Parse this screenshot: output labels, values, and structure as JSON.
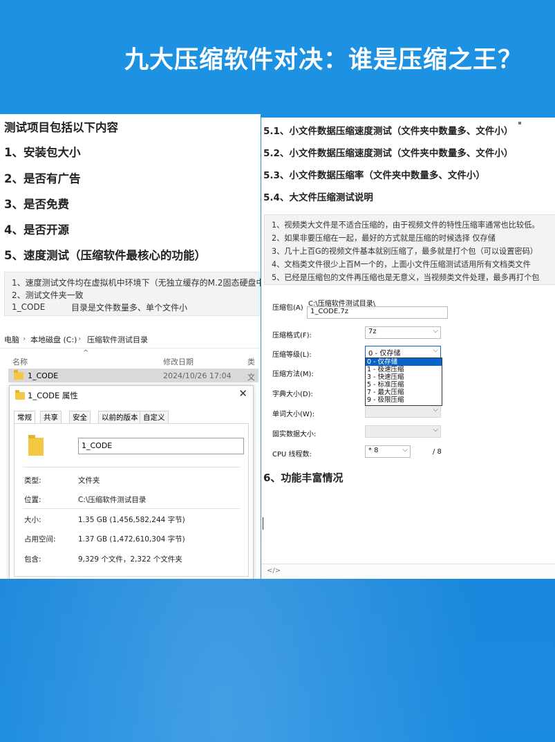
{
  "headline": "九大压缩软件对决：谁是压缩之王？",
  "left": {
    "heading": "测试项目包括以下内容",
    "items": [
      "1、安装包大小",
      "2、是否有广告",
      "3、是否免费",
      "4、是否开源",
      "5、速度测试（压缩软件最核心的功能）"
    ],
    "note_lines": [
      "1、速度测试文件均在虚拟机中环境下（无独立缓存的M.2固态硬盘中",
      "2、测试文件夹一致",
      "1_CODE",
      "目录是文件数量多、单个文件小"
    ],
    "explorer": {
      "breadcrumb": [
        "电脑",
        "本地磁盘 (C:)",
        "压缩软件测试目录"
      ],
      "columns": [
        "名称",
        "修改日期",
        "类"
      ],
      "file": {
        "name": "1_CODE",
        "date": "2024/10/26 17:04",
        "type": "文"
      }
    },
    "dialog": {
      "title": "1_CODE 属性",
      "close": "✕",
      "tabs": [
        "常规",
        "共享",
        "安全",
        "以前的版本",
        "自定义"
      ],
      "name": "1_CODE",
      "props": [
        {
          "label": "类型:",
          "value": "文件夹"
        },
        {
          "label": "位置:",
          "value": "C:\\压缩软件测试目录"
        },
        {
          "label": "大小:",
          "value": "1.35 GB (1,456,582,244 字节)"
        },
        {
          "label": "占用空间:",
          "value": "1.37 GB (1,472,610,304 字节)"
        },
        {
          "label": "包含:",
          "value": "9,329 个文件，2,322 个文件夹"
        }
      ]
    }
  },
  "right": {
    "headings": [
      "5.1、小文件数据压缩速度测试（文件夹中数量多、文件小）",
      "5.2、小文件数据压缩速度测试（文件夹中数量多、文件小）",
      "5.3、小文件数据压缩率（文件夹中数量多、文件小）",
      "5.4、大文件压缩测试说明"
    ],
    "notes": [
      "1、视频类大文件是不适合压缩的，由于视频文件的特性压缩率通常也比较低。",
      "2、如果非要压缩在一起，最好的方式就是压缩的时候选择  仅存储",
      "3、几十上百G的视频文件基本就别压缩了，最多就是打个包（可以设置密码）",
      "4、文档类文件很少上百M一个的，上面小文件压缩测试适用所有文档类文件",
      "5、已经是压缩包的文件再压缩也是无意义，当视频类文件处理，最多再打个包"
    ],
    "zip": {
      "archive_label": "压缩包(A)",
      "archive_dir": "C:\\压缩软件测试目录\\",
      "archive_name": "1_CODE.7z",
      "format_label": "压缩格式(F):",
      "format_value": "7z",
      "level_label": "压缩等级(L):",
      "level_value": "0 - 仅存储",
      "level_options": [
        "0 - 仅存储",
        "1 - 极速压缩",
        "3 - 快速压缩",
        "5 - 标准压缩",
        "7 - 最大压缩",
        "9 - 极限压缩"
      ],
      "method_label": "压缩方法(M):",
      "dict_label": "字典大小(D):",
      "word_label": "单词大小(W):",
      "solid_label": "固实数据大小:",
      "cpu_label": "CPU 线程数:",
      "cpu_value": "* 8",
      "cpu_total": "/ 8",
      "arrow": "⌵"
    },
    "heading6": "6、功能丰富情况",
    "footer_code": "</>"
  }
}
